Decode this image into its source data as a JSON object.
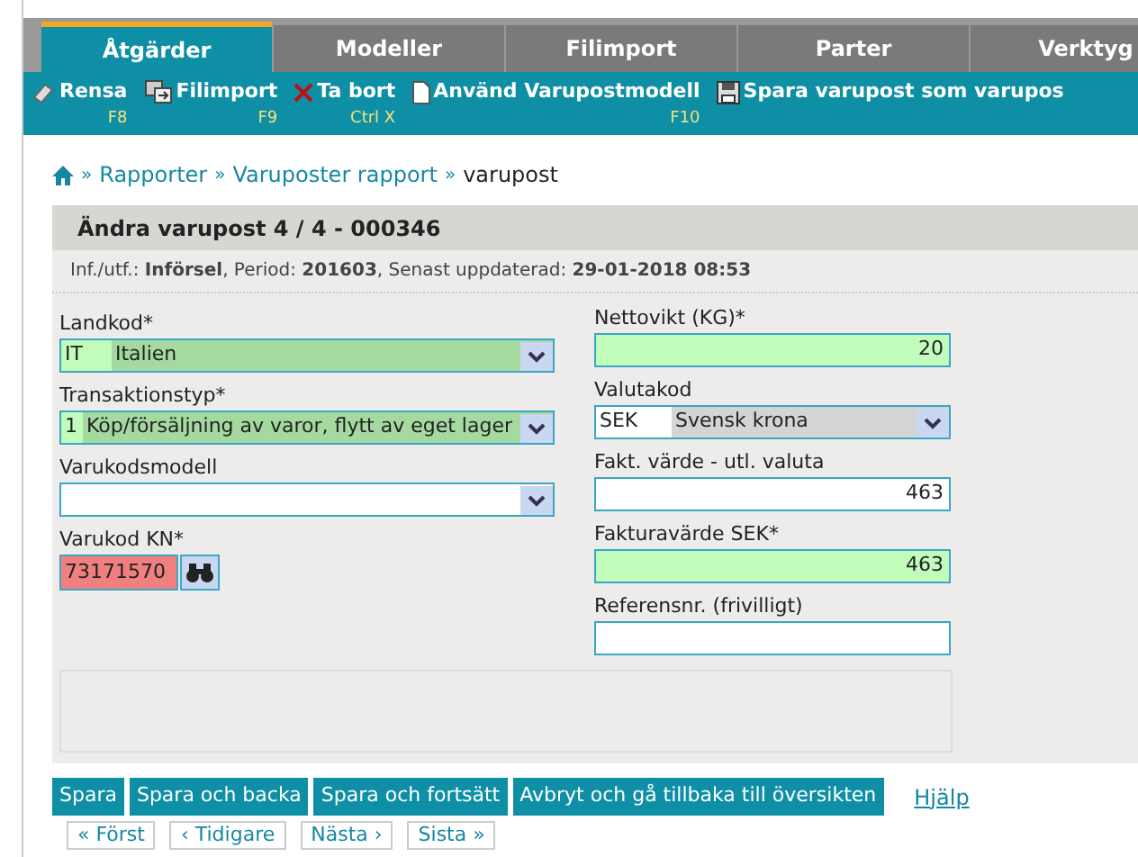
{
  "tabs": [
    {
      "label": "Åtgärder",
      "selected": true
    },
    {
      "label": "Modeller",
      "selected": false
    },
    {
      "label": "Filimport",
      "selected": false
    },
    {
      "label": "Parter",
      "selected": false
    },
    {
      "label": "Verktyg",
      "selected": false
    }
  ],
  "toolbar": [
    {
      "kind": "eraser",
      "label": "Rensa",
      "shortcut": "F8"
    },
    {
      "kind": "import",
      "label": "Filimport",
      "shortcut": "F9"
    },
    {
      "kind": "delete",
      "label": "Ta bort",
      "shortcut": "Ctrl X"
    },
    {
      "kind": "page",
      "label": "Använd Varupostmodell",
      "shortcut": "F10"
    },
    {
      "kind": "save",
      "label": "Spara varupost som varupos"
    }
  ],
  "breadcrumb": [
    {
      "separator": "»",
      "label": "Rapporter",
      "kind": "link"
    },
    {
      "separator": "»",
      "label": "Varuposter rapport",
      "kind": "link"
    },
    {
      "separator": "»",
      "label": "varupost",
      "kind": "current"
    }
  ],
  "panel": {
    "title": "Ändra varupost 4 / 4 - 000346",
    "info": "Inf./utf.: **Införsel**, Period: **201603**, Senast uppdaterad: **29-01-2018 08:53**"
  },
  "left_fields": [
    {
      "label": "Landkod*",
      "kind": "code-select",
      "code": "IT",
      "value": "Italien",
      "required": true,
      "error": false,
      "readonly": false
    },
    {
      "label": "Transaktionstyp*",
      "kind": "code-select",
      "code": "1",
      "value": "Köp/försäljning av varor, flytt av eget lager",
      "required": true,
      "error": false,
      "readonly": false
    },
    {
      "label": "Varukodsmodell",
      "kind": "select",
      "required": false,
      "error": false,
      "readonly": false
    },
    {
      "label": "Varukod KN*",
      "kind": "lookup",
      "value": "73171570",
      "required": true,
      "error": true,
      "readonly": false
    }
  ],
  "right_fields": [
    {
      "label": "Nettovikt (KG)*",
      "kind": "text",
      "value": "20",
      "required": true,
      "error": false,
      "readonly": false
    },
    {
      "label": "Valutakod",
      "kind": "code-select",
      "code": "SEK",
      "value": "Svensk krona",
      "required": false,
      "error": false,
      "readonly": true
    },
    {
      "label": "Fakt. värde - utl. valuta",
      "kind": "text",
      "value": "463",
      "required": false,
      "error": false,
      "readonly": false
    },
    {
      "label": "Fakturavärde SEK*",
      "kind": "text",
      "value": "463",
      "required": true,
      "error": false,
      "readonly": false
    },
    {
      "label": "Referensnr. (frivilligt)",
      "kind": "text",
      "required": false,
      "error": false,
      "readonly": false
    }
  ],
  "actions": [
    "Spara",
    "Spara och backa",
    "Spara och fortsätt",
    "Avbryt och gå tillbaka till översikten"
  ],
  "help_link": "Hjälp",
  "pager": [
    "« Först",
    "‹ Tidigare",
    "Nästa ›",
    "Sista »"
  ]
}
